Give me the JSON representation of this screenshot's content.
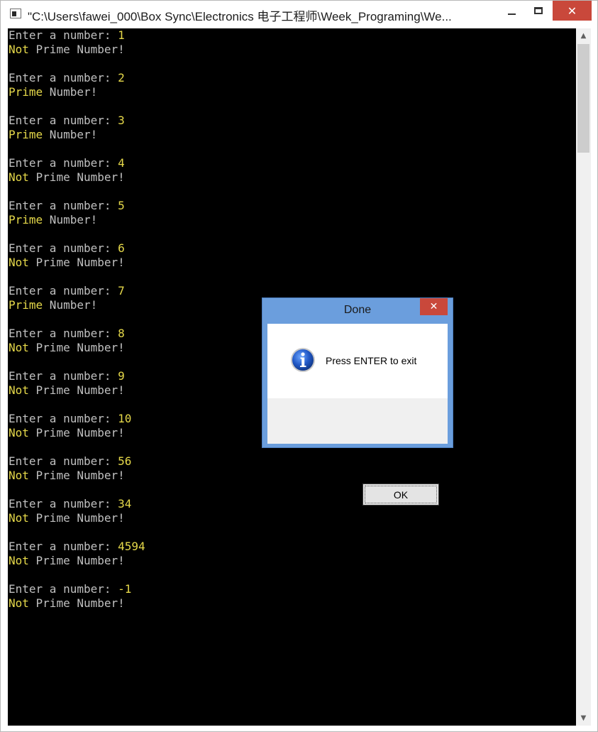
{
  "window": {
    "title": "\"C:\\Users\\fawei_000\\Box Sync\\Electronics 电子工程师\\Week_Programing\\We...",
    "close_glyph": "✕"
  },
  "console": {
    "lines": [
      [
        {
          "t": "Enter a number: ",
          "c": "gray"
        },
        {
          "t": "1",
          "c": "yellow"
        }
      ],
      [
        {
          "t": "Not",
          "c": "yellow"
        },
        {
          "t": " Prime Number!",
          "c": "gray"
        }
      ],
      [],
      [
        {
          "t": "Enter a number: ",
          "c": "gray"
        },
        {
          "t": "2",
          "c": "yellow"
        }
      ],
      [
        {
          "t": "Prime",
          "c": "yellow"
        },
        {
          "t": " Number!",
          "c": "gray"
        }
      ],
      [],
      [
        {
          "t": "Enter a number: ",
          "c": "gray"
        },
        {
          "t": "3",
          "c": "yellow"
        }
      ],
      [
        {
          "t": "Prime",
          "c": "yellow"
        },
        {
          "t": " Number!",
          "c": "gray"
        }
      ],
      [],
      [
        {
          "t": "Enter a number: ",
          "c": "gray"
        },
        {
          "t": "4",
          "c": "yellow"
        }
      ],
      [
        {
          "t": "Not",
          "c": "yellow"
        },
        {
          "t": " Prime Number!",
          "c": "gray"
        }
      ],
      [],
      [
        {
          "t": "Enter a number: ",
          "c": "gray"
        },
        {
          "t": "5",
          "c": "yellow"
        }
      ],
      [
        {
          "t": "Prime",
          "c": "yellow"
        },
        {
          "t": " Number!",
          "c": "gray"
        }
      ],
      [],
      [
        {
          "t": "Enter a number: ",
          "c": "gray"
        },
        {
          "t": "6",
          "c": "yellow"
        }
      ],
      [
        {
          "t": "Not",
          "c": "yellow"
        },
        {
          "t": " Prime Number!",
          "c": "gray"
        }
      ],
      [],
      [
        {
          "t": "Enter a number: ",
          "c": "gray"
        },
        {
          "t": "7",
          "c": "yellow"
        }
      ],
      [
        {
          "t": "Prime",
          "c": "yellow"
        },
        {
          "t": " Number!",
          "c": "gray"
        }
      ],
      [],
      [
        {
          "t": "Enter a number: ",
          "c": "gray"
        },
        {
          "t": "8",
          "c": "yellow"
        }
      ],
      [
        {
          "t": "Not",
          "c": "yellow"
        },
        {
          "t": " Prime Number!",
          "c": "gray"
        }
      ],
      [],
      [
        {
          "t": "Enter a number: ",
          "c": "gray"
        },
        {
          "t": "9",
          "c": "yellow"
        }
      ],
      [
        {
          "t": "Not",
          "c": "yellow"
        },
        {
          "t": " Prime Number!",
          "c": "gray"
        }
      ],
      [],
      [
        {
          "t": "Enter a number: ",
          "c": "gray"
        },
        {
          "t": "10",
          "c": "yellow"
        }
      ],
      [
        {
          "t": "Not",
          "c": "yellow"
        },
        {
          "t": " Prime Number!",
          "c": "gray"
        }
      ],
      [],
      [
        {
          "t": "Enter a number: ",
          "c": "gray"
        },
        {
          "t": "56",
          "c": "yellow"
        }
      ],
      [
        {
          "t": "Not",
          "c": "yellow"
        },
        {
          "t": " Prime Number!",
          "c": "gray"
        }
      ],
      [],
      [
        {
          "t": "Enter a number: ",
          "c": "gray"
        },
        {
          "t": "34",
          "c": "yellow"
        }
      ],
      [
        {
          "t": "Not",
          "c": "yellow"
        },
        {
          "t": " Prime Number!",
          "c": "gray"
        }
      ],
      [],
      [
        {
          "t": "Enter a number: ",
          "c": "gray"
        },
        {
          "t": "4594",
          "c": "yellow"
        }
      ],
      [
        {
          "t": "Not",
          "c": "yellow"
        },
        {
          "t": " Prime Number!",
          "c": "gray"
        }
      ],
      [],
      [
        {
          "t": "Enter a number: ",
          "c": "gray"
        },
        {
          "t": "-1",
          "c": "yellow"
        }
      ],
      [
        {
          "t": "Not",
          "c": "yellow"
        },
        {
          "t": " Prime Number!",
          "c": "gray"
        }
      ]
    ],
    "colors": {
      "background": "#000000",
      "text": "#c0c0c0",
      "highlight": "#e6d94a"
    }
  },
  "dialog": {
    "title": "Done",
    "message": "Press ENTER to exit",
    "ok_label": "OK",
    "icon": "info-icon",
    "close_glyph": "✕"
  },
  "scrollbar": {
    "up_glyph": "▲",
    "down_glyph": "▼"
  }
}
